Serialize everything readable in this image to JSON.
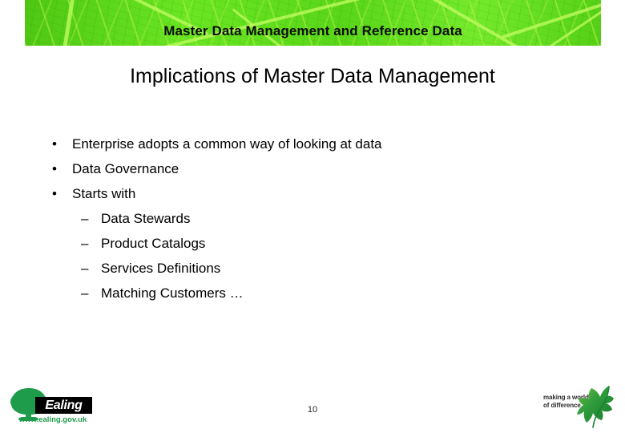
{
  "header": {
    "banner_title": "Master Data Management and Reference Data",
    "banner_color": "#58D618"
  },
  "slide": {
    "title": "Implications of Master Data Management",
    "page_number": "10"
  },
  "content": {
    "bullets": [
      {
        "level": 1,
        "marker": "•",
        "text": "Enterprise adopts a common way of looking at data"
      },
      {
        "level": 1,
        "marker": "•",
        "text": "Data Governance"
      },
      {
        "level": 1,
        "marker": "•",
        "text": "Starts with"
      },
      {
        "level": 2,
        "marker": "–",
        "text": "Data Stewards"
      },
      {
        "level": 2,
        "marker": "–",
        "text": "Product Catalogs"
      },
      {
        "level": 2,
        "marker": "–",
        "text": "Services Definitions"
      },
      {
        "level": 2,
        "marker": "–",
        "text": "Matching Customers …"
      }
    ]
  },
  "footer": {
    "ealing_logo": {
      "wordmark": "Ealing",
      "url": "www.ealing.gov.uk",
      "green": "#1E9B4B"
    },
    "tagline_logo": {
      "line1": "making a world",
      "line2": "of difference",
      "leaf_green": "#2E9B3C"
    }
  }
}
